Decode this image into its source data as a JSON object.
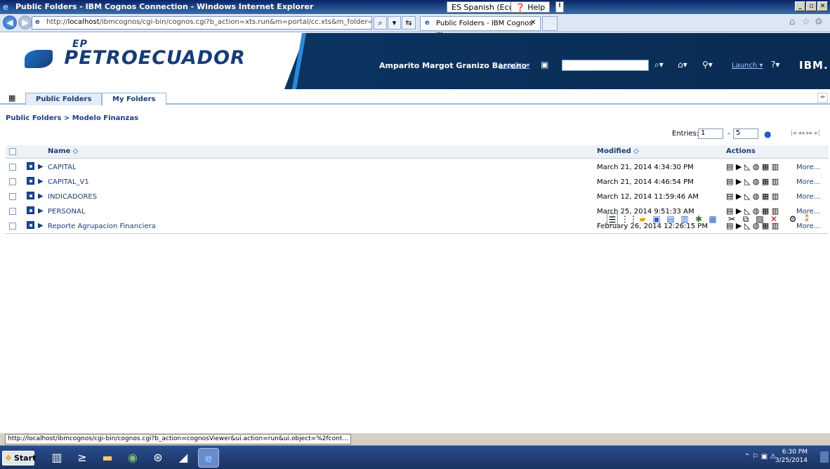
{
  "window": {
    "title": "Public Folders - IBM Cognos Connection - Windows Internet Explorer",
    "language": "ES Spanish (Ecuador)",
    "help": "Help"
  },
  "browser": {
    "url_prefix": "http://",
    "url_host": "localhost",
    "url_path": "/ibmcognos/cgi-bin/cognos.cgi?b_action=xts.run&m=portal/cc.xts&m_folder=i0€",
    "tab_title": "Public Folders - IBM Cognos ..."
  },
  "header": {
    "logo_ep": "EP",
    "logo_text": "PETROECUADOR",
    "user_name": "Amparito Margot Granizo Barreno",
    "log_on": "Log On",
    "launch": "Launch",
    "brand": "IBM."
  },
  "tabs": [
    {
      "label": "Public Folders",
      "selected": true
    },
    {
      "label": "My Folders",
      "selected": false
    }
  ],
  "breadcrumb": "Public Folders > Modelo Finanzas",
  "pager": {
    "entries_label": "Entries:",
    "from": "1",
    "dash": "-",
    "to": "5"
  },
  "grid": {
    "headers": {
      "name": "Name ◇",
      "modified": "Modified ◇",
      "actions": "Actions"
    },
    "rows": [
      {
        "name": "CAPITAL",
        "modified": "March 21, 2014 4:34:30 PM",
        "more": "More..."
      },
      {
        "name": "CAPITAL_V1",
        "modified": "March 21, 2014 4:46:54 PM",
        "more": "More..."
      },
      {
        "name": "INDICADORES",
        "modified": "March 12, 2014 11:59:46 AM",
        "more": "More..."
      },
      {
        "name": "PERSONAL",
        "modified": "March 25, 2014 9:51:33 AM",
        "more": "More..."
      },
      {
        "name": "Reporte Agrupacion Financiera",
        "modified": "February 26, 2014 12:26:15 PM",
        "more": "More..."
      }
    ]
  },
  "status": {
    "url": "http://localhost/ibmcognos/cgi-bin/cognos.cgi?b_action=cognosViewer&ui.action=run&ui.object=%2fcont..."
  },
  "taskbar": {
    "start": "Start",
    "time": "6:30 PM",
    "date": "3/25/2014"
  }
}
